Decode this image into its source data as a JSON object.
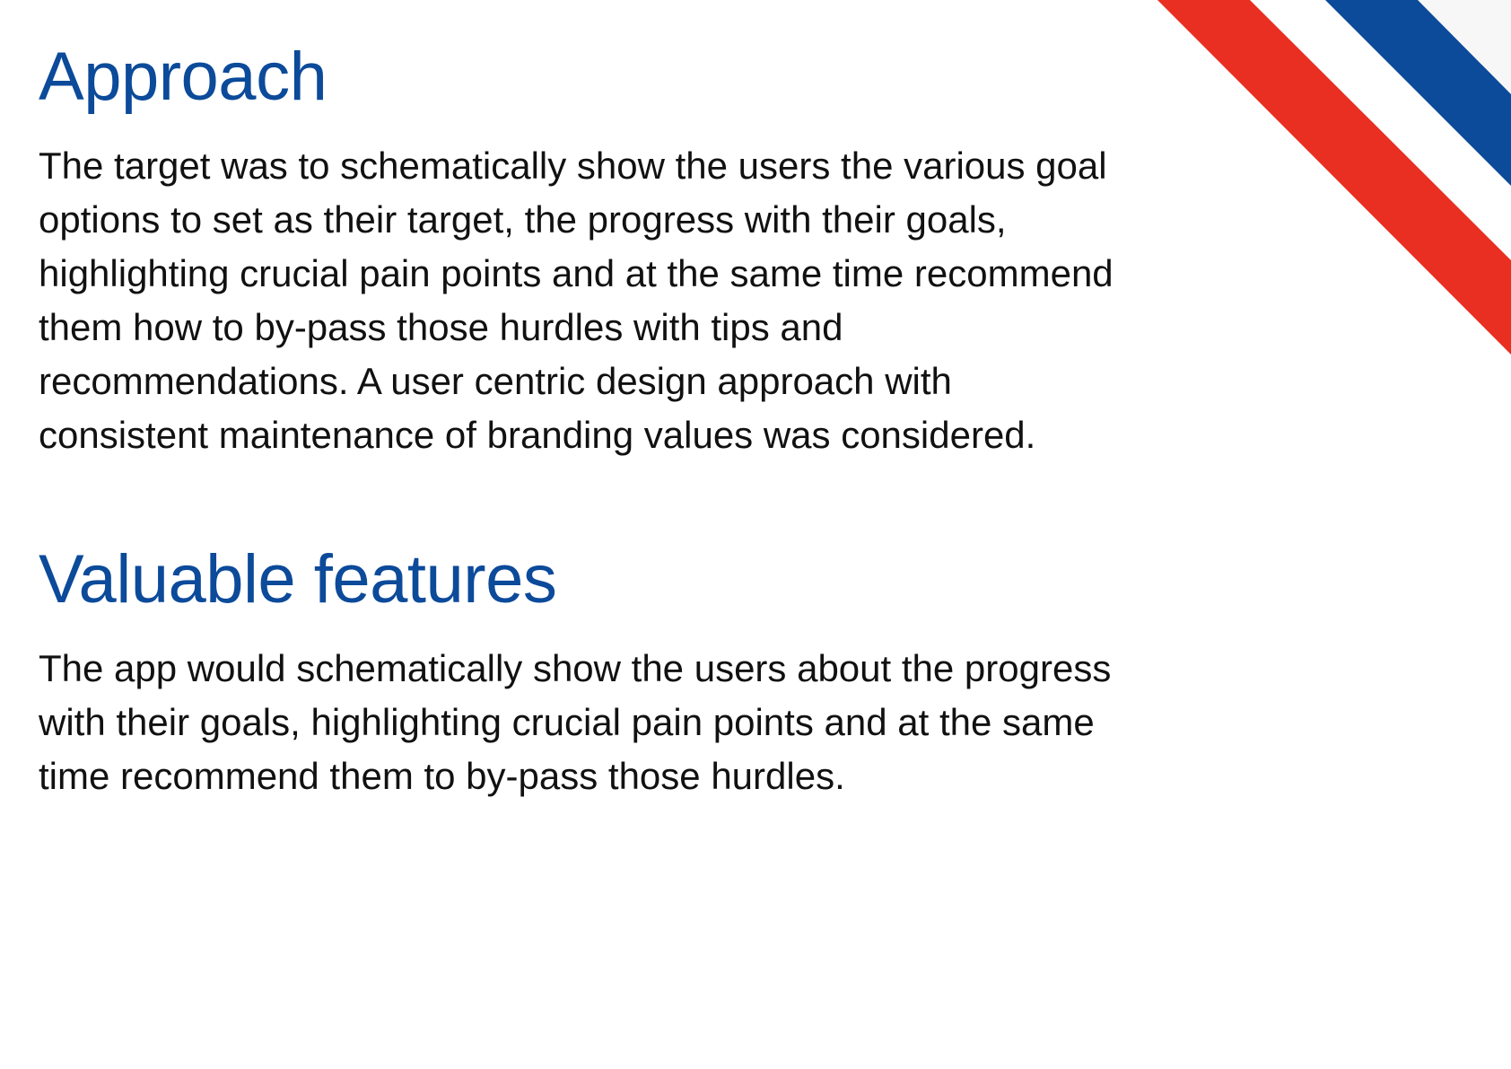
{
  "colors": {
    "heading": "#0c4a9a",
    "red_stripe": "#e82f22",
    "blue_stripe": "#0c4a9a",
    "corner": "#f7f7f7"
  },
  "approach": {
    "title": "Approach",
    "lines": [
      "The target was to schematically show the users the various goal",
      "options to set as their target, the progress with their goals,",
      "highlighting crucial pain points and at the same time recommend",
      "them how to by-pass those hurdles with tips and",
      "recommendations. A user centric design approach with",
      "consistent maintenance of branding values was considered."
    ]
  },
  "features": {
    "title": "Valuable features",
    "lines": [
      "The app would schematically show the users about the progress",
      "with their goals, highlighting crucial pain points and at the same",
      "time recommend them to by-pass those hurdles."
    ]
  }
}
